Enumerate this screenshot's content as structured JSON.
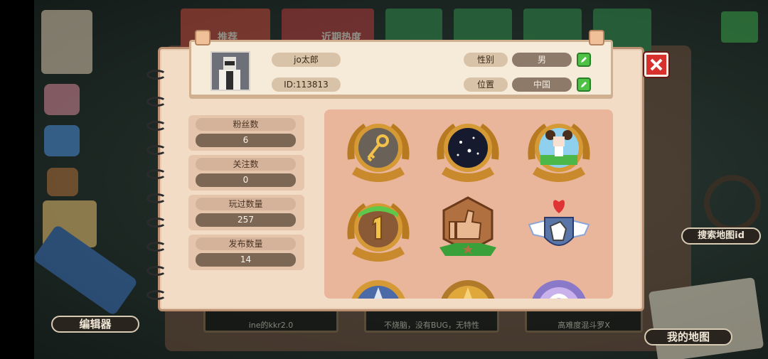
{
  "profile": {
    "name": "jo太郎",
    "id_text": "ID:113813",
    "gender_label": "性别",
    "gender_value": "男",
    "location_label": "位置",
    "location_value": "中国"
  },
  "stats": [
    {
      "label": "粉丝数",
      "value": "6"
    },
    {
      "label": "关注数",
      "value": "0"
    },
    {
      "label": "玩过数量",
      "value": "257"
    },
    {
      "label": "发布数量",
      "value": "14"
    }
  ],
  "background": {
    "tabs": [
      "推荐",
      "近期热度"
    ],
    "cards": [
      "ine的kkr2.0",
      "不烧脑，没有BUG，无特性",
      "高难度混斗罗X"
    ],
    "editor_label": "编辑器",
    "search_map_label": "搜索地图id",
    "my_map_label": "我的地图"
  },
  "badges": [
    {
      "icon": "golden-key-badge-icon"
    },
    {
      "icon": "starry-night-badge-icon"
    },
    {
      "icon": "girl-character-badge-icon"
    },
    {
      "icon": "number-one-badge-icon"
    },
    {
      "icon": "thumbs-up-badge-icon"
    },
    {
      "icon": "winged-heart-hand-badge-icon"
    },
    {
      "icon": "blue-star-badge-icon"
    },
    {
      "icon": "gold-star-badge-icon"
    },
    {
      "icon": "purple-badge-icon"
    }
  ],
  "colors": {
    "dialog_bg": "#f3dcc6",
    "badge_panel": "#e9b69b",
    "edit_green": "#4fc246",
    "close_red": "#d8302c",
    "gold": "#c98a2e"
  }
}
